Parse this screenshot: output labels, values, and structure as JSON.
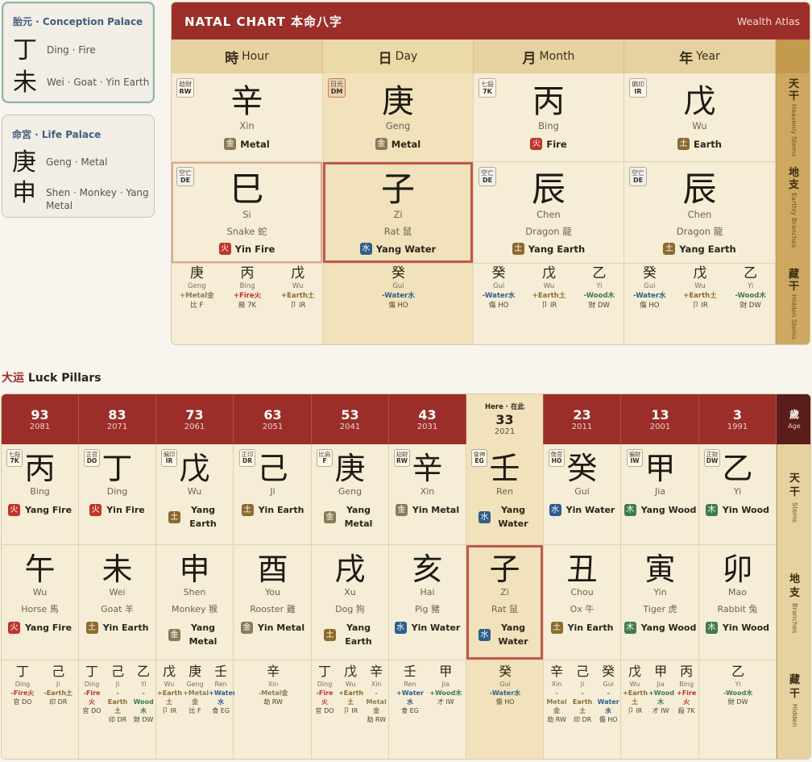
{
  "colors": {
    "fire": "#c0342c",
    "metal": "#8c7a55",
    "earth": "#8c6a2e",
    "water": "#2f5e8c",
    "wood": "#3f7a4e"
  },
  "conception": {
    "title": "胎元 · Conception Palace",
    "stem": "丁",
    "stem_label": "Ding · Fire",
    "branch": "未",
    "branch_label": "Wei · Goat · Yin Earth"
  },
  "life_palace": {
    "title": "命宮 · Life Palace",
    "stem": "庚",
    "stem_label": "Geng · Metal",
    "branch": "申",
    "branch_label": "Shen · Monkey · Yang Metal"
  },
  "natal": {
    "title": "NATAL CHART  本命八字",
    "brand": "Wealth Atlas",
    "columns": [
      {
        "zh": "時",
        "en": "Hour"
      },
      {
        "zh": "日",
        "en": "Day"
      },
      {
        "zh": "月",
        "en": "Month"
      },
      {
        "zh": "年",
        "en": "Year"
      }
    ],
    "side": [
      {
        "zh": "天干",
        "en": "Heavenly Stems"
      },
      {
        "zh": "地支",
        "en": "Earthly Branches"
      },
      {
        "zh": "藏干",
        "en": "Hidden Stems"
      }
    ],
    "stems": [
      {
        "tag": "劫財",
        "code": "RW",
        "glyph": "辛",
        "py": "Xin",
        "elem_box": "金",
        "elem_label": "Metal",
        "elem": "metal"
      },
      {
        "tag": "日元",
        "code": "DM",
        "glyph": "庚",
        "py": "Geng",
        "elem_box": "金",
        "elem_label": "Metal",
        "elem": "metal"
      },
      {
        "tag": "七殺",
        "code": "7K",
        "glyph": "丙",
        "py": "Bing",
        "elem_box": "火",
        "elem_label": "Fire",
        "elem": "fire"
      },
      {
        "tag": "偏印",
        "code": "IR",
        "glyph": "戊",
        "py": "Wu",
        "elem_box": "土",
        "elem_label": "Earth",
        "elem": "earth"
      }
    ],
    "branches": [
      {
        "tag": "空亡",
        "code": "DE",
        "glyph": "巳",
        "py": "Si",
        "animal": "Snake 蛇",
        "elem_box": "火",
        "elem_label": "Yin Fire",
        "elem": "fire"
      },
      {
        "tag": "",
        "code": "",
        "glyph": "子",
        "py": "Zi",
        "animal": "Rat 鼠",
        "elem_box": "水",
        "elem_label": "Yang Water",
        "elem": "water"
      },
      {
        "tag": "空亡",
        "code": "DE",
        "glyph": "辰",
        "py": "Chen",
        "animal": "Dragon 龍",
        "elem_box": "土",
        "elem_label": "Yang Earth",
        "elem": "earth"
      },
      {
        "tag": "空亡",
        "code": "DE",
        "glyph": "辰",
        "py": "Chen",
        "animal": "Dragon 龍",
        "elem_box": "土",
        "elem_label": "Yang Earth",
        "elem": "earth"
      }
    ],
    "hidden": [
      [
        {
          "g": "庚",
          "p": "Geng",
          "e": "+Metal金",
          "c": "metal",
          "r": "比 F"
        },
        {
          "g": "丙",
          "p": "Bing",
          "e": "+Fire火",
          "c": "fire",
          "r": "殺 7K"
        },
        {
          "g": "戊",
          "p": "Wu",
          "e": "+Earth土",
          "c": "earth",
          "r": "卩 IR"
        }
      ],
      [
        {
          "g": "癸",
          "p": "Gui",
          "e": "-Water水",
          "c": "water",
          "r": "傷 HO"
        }
      ],
      [
        {
          "g": "癸",
          "p": "Gui",
          "e": "-Water水",
          "c": "water",
          "r": "傷 HO"
        },
        {
          "g": "戊",
          "p": "Wu",
          "e": "+Earth土",
          "c": "earth",
          "r": "卩 IR"
        },
        {
          "g": "乙",
          "p": "Yi",
          "e": "-Wood木",
          "c": "wood",
          "r": "財 DW"
        }
      ],
      [
        {
          "g": "癸",
          "p": "Gui",
          "e": "-Water水",
          "c": "water",
          "r": "傷 HO"
        },
        {
          "g": "戊",
          "p": "Wu",
          "e": "+Earth土",
          "c": "earth",
          "r": "卩 IR"
        },
        {
          "g": "乙",
          "p": "Yi",
          "e": "-Wood木",
          "c": "wood",
          "r": "財 DW"
        }
      ]
    ]
  },
  "luck": {
    "title_zh": "大运",
    "title_en": "Luck Pillars",
    "age_zh": "歲",
    "age_en": "Age",
    "side": [
      {
        "zh": "天干",
        "en": "Stems"
      },
      {
        "zh": "地支",
        "en": "Branches"
      },
      {
        "zh": "藏干",
        "en": "Hidden"
      }
    ],
    "here": "Here · 在此",
    "pillars": [
      {
        "age": "93",
        "year": "2081",
        "stem": {
          "tag": "七殺",
          "code": "7K",
          "glyph": "丙",
          "py": "Bing",
          "box": "火",
          "label": "Yang Fire",
          "elem": "fire"
        },
        "branch": {
          "glyph": "午",
          "py": "Wu",
          "animal": "Horse 馬",
          "box": "火",
          "label": "Yang Fire",
          "elem": "fire"
        },
        "hidden": [
          {
            "g": "丁",
            "p": "Ding",
            "e": "-Fire火",
            "c": "fire",
            "r": "官 DO"
          },
          {
            "g": "己",
            "p": "Ji",
            "e": "-Earth土",
            "c": "earth",
            "r": "印 DR"
          }
        ]
      },
      {
        "age": "83",
        "year": "2071",
        "stem": {
          "tag": "正官",
          "code": "DO",
          "glyph": "丁",
          "py": "Ding",
          "box": "火",
          "label": "Yin Fire",
          "elem": "fire"
        },
        "branch": {
          "glyph": "未",
          "py": "Wei",
          "animal": "Goat 羊",
          "box": "土",
          "label": "Yin Earth",
          "elem": "earth"
        },
        "hidden": [
          {
            "g": "丁",
            "p": "Ding",
            "e": "-Fire 火",
            "c": "fire",
            "r": "官 DO"
          },
          {
            "g": "己",
            "p": "Ji",
            "e": "- Earth 土",
            "c": "earth",
            "r": "印 DR"
          },
          {
            "g": "乙",
            "p": "Yi",
            "e": "- Wood 木",
            "c": "wood",
            "r": "財 DW"
          }
        ]
      },
      {
        "age": "73",
        "year": "2061",
        "stem": {
          "tag": "偏印",
          "code": "IR",
          "glyph": "戊",
          "py": "Wu",
          "box": "土",
          "label": "Yang Earth",
          "elem": "earth"
        },
        "branch": {
          "glyph": "申",
          "py": "Shen",
          "animal": "Monkey 猴",
          "box": "金",
          "label": "Yang Metal",
          "elem": "metal"
        },
        "hidden": [
          {
            "g": "戊",
            "p": "Wu",
            "e": "+Earth 土",
            "c": "earth",
            "r": "卩 IR"
          },
          {
            "g": "庚",
            "p": "Geng",
            "e": "+Metal 金",
            "c": "metal",
            "r": "比 F"
          },
          {
            "g": "壬",
            "p": "Ren",
            "e": "+Water 水",
            "c": "water",
            "r": "食 EG"
          }
        ]
      },
      {
        "age": "63",
        "year": "2051",
        "stem": {
          "tag": "正印",
          "code": "DR",
          "glyph": "己",
          "py": "Ji",
          "box": "土",
          "label": "Yin Earth",
          "elem": "earth"
        },
        "branch": {
          "glyph": "酉",
          "py": "You",
          "animal": "Rooster 雞",
          "box": "金",
          "label": "Yin Metal",
          "elem": "metal"
        },
        "hidden": [
          {
            "g": "辛",
            "p": "Xin",
            "e": "-Metal金",
            "c": "metal",
            "r": "劫 RW"
          }
        ]
      },
      {
        "age": "53",
        "year": "2041",
        "stem": {
          "tag": "比肩",
          "code": "F",
          "glyph": "庚",
          "py": "Geng",
          "box": "金",
          "label": "Yang Metal",
          "elem": "metal"
        },
        "branch": {
          "glyph": "戌",
          "py": "Xu",
          "animal": "Dog 狗",
          "box": "土",
          "label": "Yang Earth",
          "elem": "earth"
        },
        "hidden": [
          {
            "g": "丁",
            "p": "Ding",
            "e": "-Fire 火",
            "c": "fire",
            "r": "官 DO"
          },
          {
            "g": "戊",
            "p": "Wu",
            "e": "+Earth 土",
            "c": "earth",
            "r": "卩 IR"
          },
          {
            "g": "辛",
            "p": "Xin",
            "e": "- Metal 金",
            "c": "metal",
            "r": "劫 RW"
          }
        ]
      },
      {
        "age": "43",
        "year": "2031",
        "stem": {
          "tag": "劫財",
          "code": "RW",
          "glyph": "辛",
          "py": "Xin",
          "box": "金",
          "label": "Yin Metal",
          "elem": "metal"
        },
        "branch": {
          "glyph": "亥",
          "py": "Hai",
          "animal": "Pig 豬",
          "box": "水",
          "label": "Yin Water",
          "elem": "water"
        },
        "hidden": [
          {
            "g": "壬",
            "p": "Ren",
            "e": "+Water 水",
            "c": "water",
            "r": "食 EG"
          },
          {
            "g": "甲",
            "p": "Jia",
            "e": "+Wood木",
            "c": "wood",
            "r": "才 IW"
          }
        ]
      },
      {
        "age": "33",
        "year": "2021",
        "current": true,
        "stem": {
          "tag": "食神",
          "code": "EG",
          "glyph": "壬",
          "py": "Ren",
          "box": "水",
          "label": "Yang Water",
          "elem": "water"
        },
        "branch": {
          "glyph": "子",
          "py": "Zi",
          "animal": "Rat 鼠",
          "box": "水",
          "label": "Yang Water",
          "elem": "water"
        },
        "hidden": [
          {
            "g": "癸",
            "p": "Gui",
            "e": "-Water水",
            "c": "water",
            "r": "傷 HO"
          }
        ]
      },
      {
        "age": "23",
        "year": "2011",
        "stem": {
          "tag": "傷官",
          "code": "HO",
          "glyph": "癸",
          "py": "Gui",
          "box": "水",
          "label": "Yin Water",
          "elem": "water"
        },
        "branch": {
          "glyph": "丑",
          "py": "Chou",
          "animal": "Ox 牛",
          "box": "土",
          "label": "Yin Earth",
          "elem": "earth"
        },
        "hidden": [
          {
            "g": "辛",
            "p": "Xin",
            "e": "- Metal 金",
            "c": "metal",
            "r": "劫 RW"
          },
          {
            "g": "己",
            "p": "Ji",
            "e": "- Earth 土",
            "c": "earth",
            "r": "印 DR"
          },
          {
            "g": "癸",
            "p": "Gui",
            "e": "- Water 水",
            "c": "water",
            "r": "傷 HO"
          }
        ]
      },
      {
        "age": "13",
        "year": "2001",
        "stem": {
          "tag": "偏財",
          "code": "IW",
          "glyph": "甲",
          "py": "Jia",
          "box": "木",
          "label": "Yang Wood",
          "elem": "wood"
        },
        "branch": {
          "glyph": "寅",
          "py": "Yin",
          "animal": "Tiger 虎",
          "box": "木",
          "label": "Yang Wood",
          "elem": "wood"
        },
        "hidden": [
          {
            "g": "戊",
            "p": "Wu",
            "e": "+Earth 土",
            "c": "earth",
            "r": "卩 IR"
          },
          {
            "g": "甲",
            "p": "Jia",
            "e": "+Wood 木",
            "c": "wood",
            "r": "才 IW"
          },
          {
            "g": "丙",
            "p": "Bing",
            "e": "+Fire 火",
            "c": "fire",
            "r": "殺 7K"
          }
        ]
      },
      {
        "age": "3",
        "year": "1991",
        "stem": {
          "tag": "正財",
          "code": "DW",
          "glyph": "乙",
          "py": "Yi",
          "box": "木",
          "label": "Yin Wood",
          "elem": "wood"
        },
        "branch": {
          "glyph": "卯",
          "py": "Mao",
          "animal": "Rabbit 兔",
          "box": "木",
          "label": "Yin Wood",
          "elem": "wood"
        },
        "hidden": [
          {
            "g": "乙",
            "p": "Yi",
            "e": "-Wood木",
            "c": "wood",
            "r": "財 DW"
          }
        ]
      }
    ]
  }
}
